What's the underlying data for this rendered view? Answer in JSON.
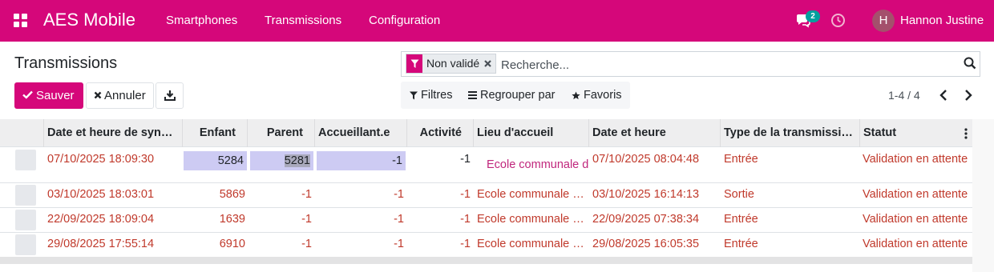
{
  "navbar": {
    "brand": "AES Mobile",
    "menu": [
      "Smartphones",
      "Transmissions",
      "Configuration"
    ],
    "chat_count": "2",
    "user_initial": "H",
    "user_name": "Hannon Justine",
    "color": "#d5077a"
  },
  "control_panel": {
    "title": "Transmissions",
    "save_label": "Sauver",
    "cancel_label": "Annuler",
    "facet_label": "Non validé",
    "search_placeholder": "Recherche...",
    "filters_label": "Filtres",
    "group_by_label": "Regrouper par",
    "favorites_label": "Favoris",
    "pager": "1-4 / 4"
  },
  "table": {
    "columns": [
      "Date et heure de syn…",
      "Enfant",
      "Parent",
      "Accueillant.e",
      "Activité",
      "Lieu d'accueil",
      "Date et heure",
      "Type de la transmissi…",
      "Statut"
    ],
    "editing_row": {
      "sync_date": "07/10/2025 18:09:30",
      "enfant": "5284",
      "parent": "5281",
      "accueillant": "-1",
      "activite": "-1",
      "lieu": "Ecole communale d",
      "date": "07/10/2025 08:04:48",
      "type": "Entrée",
      "statut": "Validation en attente"
    },
    "rows": [
      {
        "sync_date": "03/10/2025 18:03:01",
        "enfant": "5869",
        "parent": "-1",
        "accueillant": "-1",
        "activite": "-1",
        "lieu": "Ecole communale …",
        "date": "03/10/2025 16:14:13",
        "type": "Sortie",
        "statut": "Validation en attente"
      },
      {
        "sync_date": "22/09/2025 18:09:04",
        "enfant": "1639",
        "parent": "-1",
        "accueillant": "-1",
        "activite": "-1",
        "lieu": "Ecole communale …",
        "date": "22/09/2025 07:38:34",
        "type": "Entrée",
        "statut": "Validation en attente"
      },
      {
        "sync_date": "29/08/2025 17:55:14",
        "enfant": "6910",
        "parent": "-1",
        "accueillant": "-1",
        "activite": "-1",
        "lieu": "Ecole communale …",
        "date": "29/08/2025 16:05:35",
        "type": "Entrée",
        "statut": "Validation en attente"
      }
    ]
  }
}
